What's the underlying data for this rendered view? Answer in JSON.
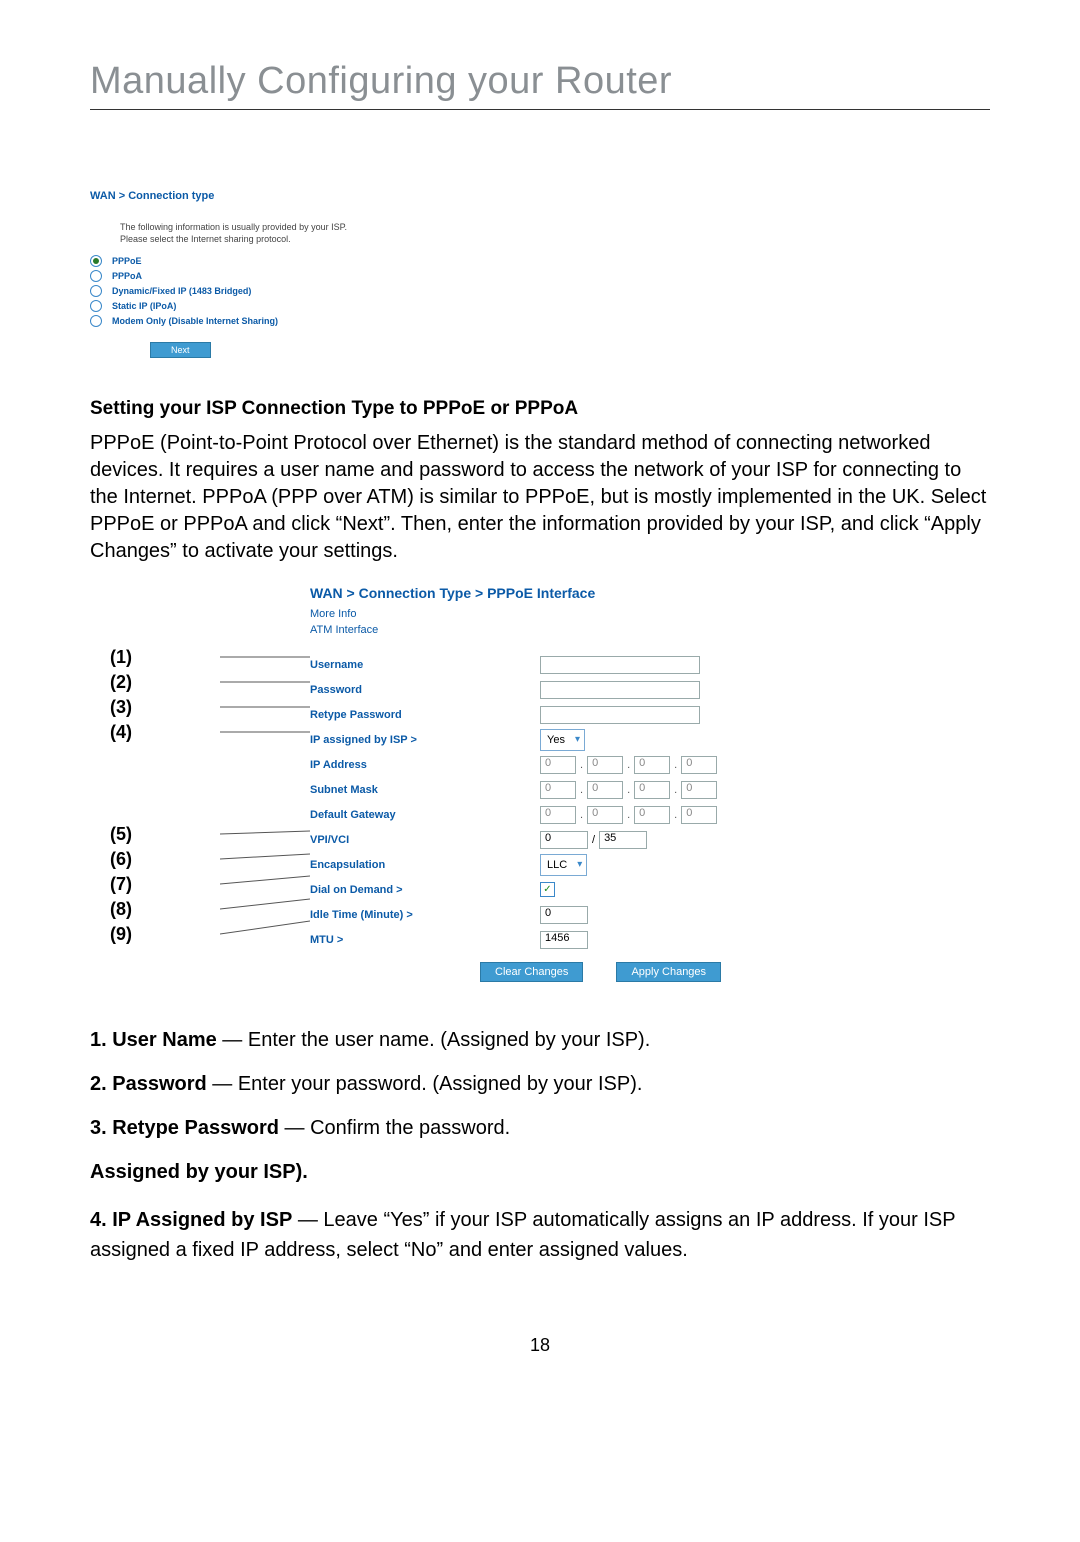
{
  "page_title": "Manually Configuring your Router",
  "page_number": "18",
  "shot1": {
    "breadcrumb": "WAN > Connection type",
    "info_line1": "The following information is usually provided by your ISP.",
    "info_line2": "Please select the Internet sharing protocol.",
    "options": [
      {
        "label": "PPPoE",
        "selected": true
      },
      {
        "label": "PPPoA",
        "selected": false
      },
      {
        "label": "Dynamic/Fixed IP (1483 Bridged)",
        "selected": false
      },
      {
        "label": "Static IP (IPoA)",
        "selected": false
      },
      {
        "label": "Modem Only (Disable Internet Sharing)",
        "selected": false
      }
    ],
    "next_button": "Next"
  },
  "section_heading": "Setting your ISP Connection Type to PPPoE or PPPoA",
  "section_para": "PPPoE (Point-to-Point Protocol over Ethernet) is the standard method of connecting networked devices. It requires a user name and password to access the network of your ISP for connecting to the Internet. PPPoA (PPP over ATM) is similar to PPPoE, but is mostly implemented in the UK. Select PPPoE or PPPoA and click “Next”. Then, enter the information provided by your ISP, and click “Apply Changes” to activate your settings.",
  "shot2": {
    "breadcrumb": "WAN > Connection Type > PPPoE Interface",
    "subline1": "More Info",
    "subline2": "ATM Interface",
    "labels": {
      "username": "Username",
      "password": "Password",
      "retype": "Retype Password",
      "ip_assigned": "IP assigned by ISP >",
      "ip_address": "IP Address",
      "subnet": "Subnet Mask",
      "gateway": "Default Gateway",
      "vpivci": "VPI/VCI",
      "encap": "Encapsulation",
      "dial": "Dial on Demand >",
      "idle": "Idle Time (Minute) >",
      "mtu": "MTU >"
    },
    "values": {
      "ip_assigned_sel": "Yes",
      "ipaddr": [
        "0",
        "0",
        "0",
        "0"
      ],
      "subnet": [
        "0",
        "0",
        "0",
        "0"
      ],
      "gateway": [
        "0",
        "0",
        "0",
        "0"
      ],
      "vpi": "0",
      "vci": "35",
      "encap_sel": "LLC",
      "dial_checked": "✓",
      "idle": "0",
      "mtu": "1456"
    },
    "buttons": {
      "clear": "Clear Changes",
      "apply": "Apply Changes"
    },
    "callouts": [
      "(1)",
      "(2)",
      "(3)",
      "(4)",
      "(5)",
      "(6)",
      "(7)",
      "(8)",
      "(9)"
    ]
  },
  "definitions": {
    "d1_b": "1. User Name",
    "d1_t": " — Enter the user name. (Assigned by your ISP).",
    "d2_b": "2. Password",
    "d2_t": " — Enter your password. (Assigned by your ISP).",
    "d3_b": "3. Retype Password",
    "d3_t": " — Confirm the password.",
    "assigned": "Assigned by your ISP).",
    "d4_b": "4. IP Assigned by ISP",
    "d4_t": " — Leave “Yes” if your ISP automatically assigns an IP address. If your ISP assigned a fixed IP address, select “No” and enter assigned values."
  }
}
